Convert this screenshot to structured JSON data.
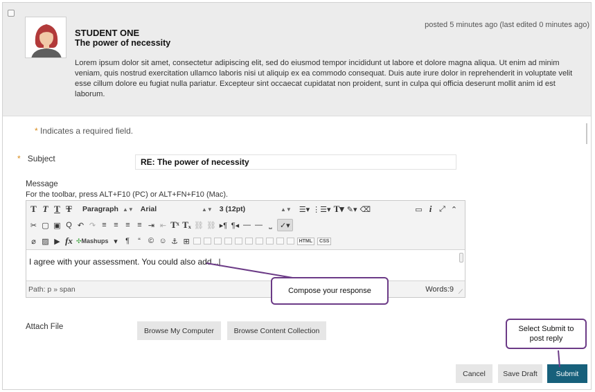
{
  "post": {
    "author": "STUDENT ONE",
    "title": "The power of necessity",
    "meta": "posted 5 minutes ago (last edited 0 minutes ago)",
    "body": "Lorem ipsum dolor sit amet, consectetur adipiscing elit, sed do eiusmod tempor incididunt ut labore et dolore magna aliqua. Ut enim ad minim veniam, quis nostrud exercitation ullamco laboris nisi ut aliquip ex ea commodo consequat. Duis aute irure dolor in reprehenderit in voluptate velit esse cillum dolore eu fugiat nulla pariatur. Excepteur sint occaecat cupidatat non proident, sunt in culpa qui officia deserunt mollit anim id est laborum."
  },
  "form": {
    "required_star": "*",
    "required_note": "Indicates a required field.",
    "subject_label": "Subject",
    "subject_value": "RE: The power of necessity",
    "message_label": "Message",
    "toolbar_hint": "For the toolbar, press ALT+F10 (PC) or ALT+FN+F10 (Mac).",
    "attach_label": "Attach File"
  },
  "editor": {
    "paragraph_select": "Paragraph",
    "font_select": "Arial",
    "size_select": "3 (12pt)",
    "mashups_label": "Mashups",
    "html_tag": "HTML",
    "css_tag": "CSS",
    "content": "I agree with your assessment. You could also add...",
    "path": "Path: p » span",
    "word_count": "Words:9"
  },
  "buttons": {
    "browse_computer": "Browse My Computer",
    "browse_collection": "Browse Content Collection",
    "cancel": "Cancel",
    "save_draft": "Save Draft",
    "submit": "Submit"
  },
  "callouts": {
    "compose": "Compose your response",
    "submit": "Select Submit to post reply"
  },
  "colors": {
    "post_bg": "#ececec",
    "submit_bg": "#17607b",
    "callout_border": "#6b3a86",
    "required_star": "#d88b1c"
  }
}
